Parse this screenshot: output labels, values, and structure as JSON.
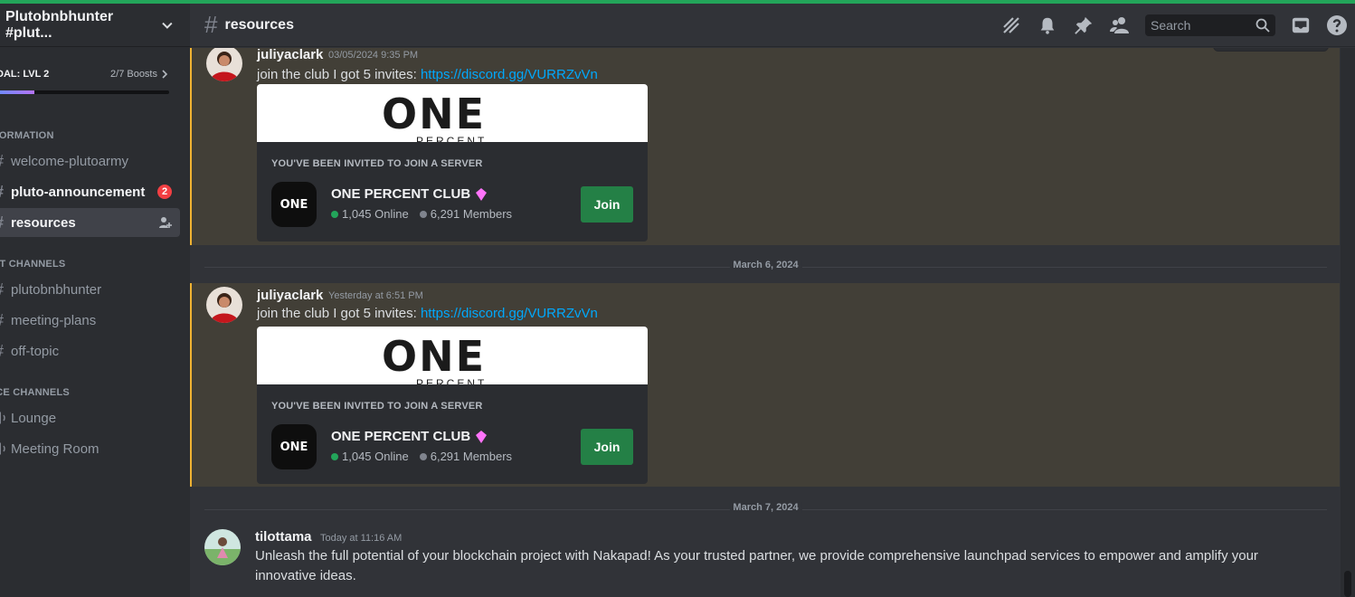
{
  "colors": {
    "accent": "#23a55a",
    "link": "#00a8fc",
    "mention_highlight": "#f0b232",
    "join": "#248046",
    "badge": "#f23f43"
  },
  "server": {
    "name": "Plutobnbhunter #plut..."
  },
  "boost": {
    "goal": "DAL: LVL 2",
    "count": "2/7 Boosts",
    "progress_fraction": 0.22
  },
  "categories": {
    "information": "FORMATION",
    "text": "XT CHANNELS",
    "voice": "ICE CHANNELS"
  },
  "channels": {
    "welcome": "welcome-plutoarmy",
    "announcement": "pluto-announcement",
    "announcement_badge": "2",
    "resources": "resources",
    "plutobnbhunter": "plutobnbhunter",
    "meeting_plans": "meeting-plans",
    "off_topic": "off-topic",
    "lounge": "Lounge",
    "meeting_room": "Meeting Room"
  },
  "header": {
    "channel": "resources",
    "search_placeholder": "Search",
    "icons": [
      "threads-icon",
      "bell-icon",
      "pin-icon",
      "members-icon",
      "inbox-icon",
      "help-icon"
    ]
  },
  "messages": [
    {
      "author": "juliyaclark",
      "timestamp": "03/05/2024 9:35 PM",
      "text": "join the club I got 5 invites: ",
      "link": "https://discord.gg/VURRZvVn",
      "embed": {
        "label": "YOU'VE BEEN INVITED TO JOIN A SERVER",
        "banner": "ONE",
        "banner_sub": "PERCENT",
        "guild": "ONE PERCENT CLUB",
        "online": "1,045 Online",
        "members": "6,291 Members",
        "join": "Join"
      }
    },
    {
      "author": "juliyaclark",
      "timestamp": "Yesterday at 6:51 PM",
      "text": "join the club I got 5 invites: ",
      "link": "https://discord.gg/VURRZvVn",
      "embed": {
        "label": "YOU'VE BEEN INVITED TO JOIN A SERVER",
        "banner": "ONE",
        "banner_sub": "PERCENT",
        "guild": "ONE PERCENT CLUB",
        "online": "1,045 Online",
        "members": "6,291 Members",
        "join": "Join"
      }
    },
    {
      "author": "tilottama",
      "timestamp": "Today at 11:16 AM",
      "text": "Unleash the full potential of your blockchain project with Nakapad! As your trusted partner, we provide comprehensive launchpad services to empower and amplify your innovative ideas."
    }
  ],
  "dividers": [
    "March 6, 2024",
    "March 7, 2024"
  ]
}
